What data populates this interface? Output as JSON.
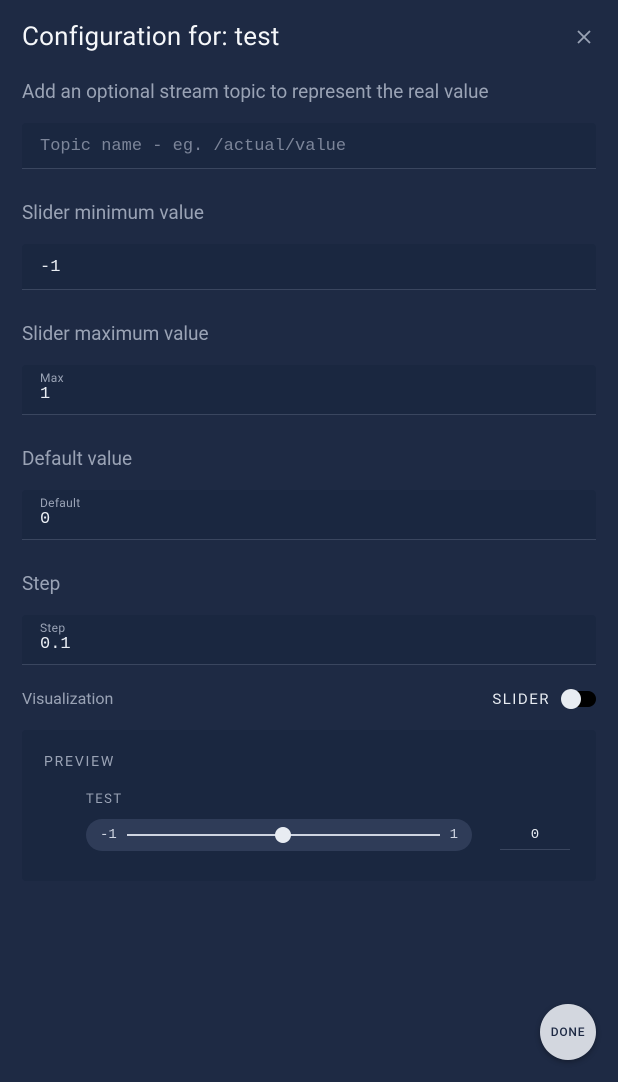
{
  "header": {
    "title": "Configuration for: test"
  },
  "stream_topic": {
    "label": "Add an optional stream topic to represent the real value",
    "placeholder": "Topic name - eg. /actual/value",
    "value": ""
  },
  "slider_min": {
    "label": "Slider minimum value",
    "value": "-1"
  },
  "slider_max": {
    "label": "Slider maximum value",
    "float_label": "Max",
    "value": "1"
  },
  "default_value": {
    "label": "Default value",
    "float_label": "Default",
    "value": "0"
  },
  "step": {
    "label": "Step",
    "float_label": "Step",
    "value": "0.1"
  },
  "visualization": {
    "label": "Visualization",
    "mode": "SLIDER",
    "toggle_on": false
  },
  "preview": {
    "title": "PREVIEW",
    "name": "TEST",
    "min": "-1",
    "max": "1",
    "current": "0"
  },
  "actions": {
    "done": "DONE"
  }
}
